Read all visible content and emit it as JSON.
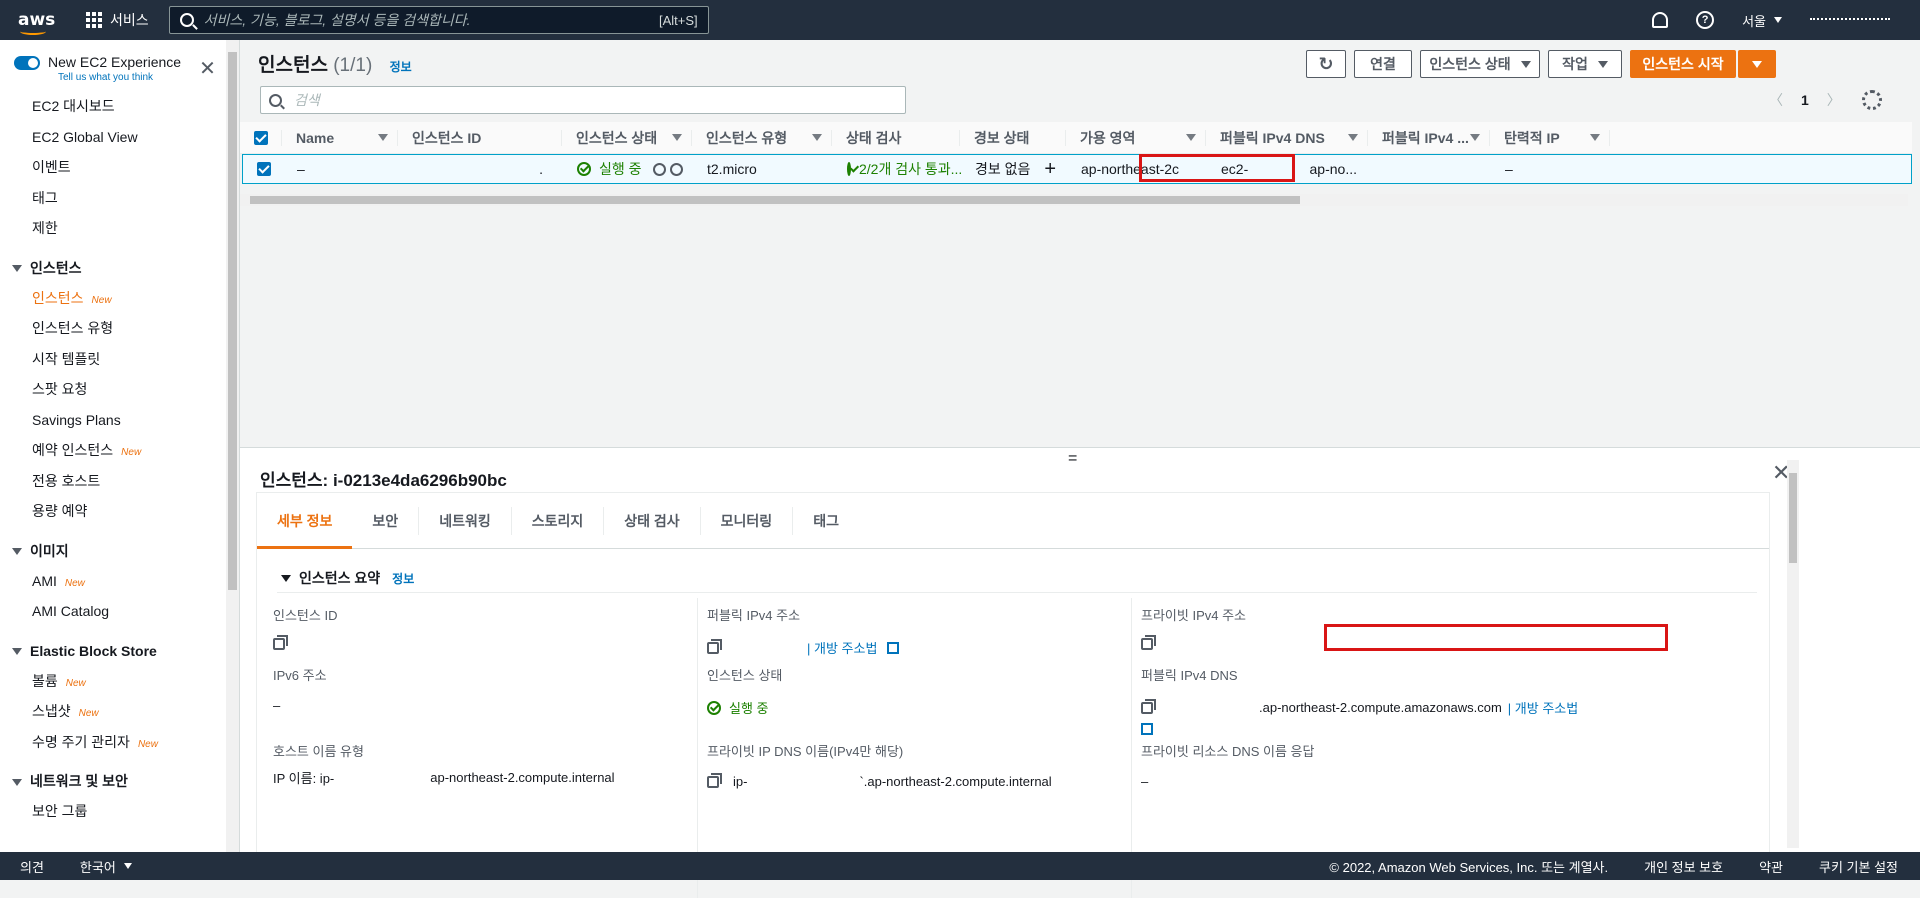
{
  "topnav": {
    "logo": "aws",
    "services_label": "서비스",
    "search_placeholder": "서비스, 기능, 블로그, 설명서 등을 검색합니다.",
    "search_shortcut": "[Alt+S]",
    "region": "서울"
  },
  "sidebar": {
    "toggle_title": "New EC2 Experience",
    "toggle_sub": "Tell us what you think",
    "top_items": [
      "EC2 대시보드",
      "EC2 Global View",
      "이벤트",
      "태그",
      "제한"
    ],
    "sections": [
      {
        "title": "인스턴스",
        "items": [
          {
            "label": "인스턴스",
            "new": "New",
            "active": true
          },
          {
            "label": "인스턴스 유형",
            "new": ""
          },
          {
            "label": "시작 템플릿",
            "new": ""
          },
          {
            "label": "스팟 요청",
            "new": ""
          },
          {
            "label": "Savings Plans",
            "new": ""
          },
          {
            "label": "예약 인스턴스",
            "new": "New"
          },
          {
            "label": "전용 호스트",
            "new": ""
          },
          {
            "label": "용량 예약",
            "new": ""
          }
        ]
      },
      {
        "title": "이미지",
        "items": [
          {
            "label": "AMI",
            "new": "New"
          },
          {
            "label": "AMI Catalog",
            "new": ""
          }
        ]
      },
      {
        "title": "Elastic Block Store",
        "items": [
          {
            "label": "볼륨",
            "new": "New"
          },
          {
            "label": "스냅샷",
            "new": "New"
          },
          {
            "label": "수명 주기 관리자",
            "new": "New"
          }
        ]
      },
      {
        "title": "네트워크 및 보안",
        "items": [
          {
            "label": "보안 그룹",
            "new": ""
          }
        ]
      }
    ]
  },
  "header": {
    "title": "인스턴스",
    "count": "(1/1)",
    "info": "정보",
    "btn_refresh": "↻",
    "btn_connect": "연결",
    "btn_state": "인스턴스 상태",
    "btn_actions": "작업",
    "btn_launch": "인스턴스 시작",
    "filter_placeholder": "검색",
    "page": "1"
  },
  "table": {
    "columns": [
      "Name",
      "인스턴스 ID",
      "인스턴스 상태",
      "인스턴스 유형",
      "상태 검사",
      "경보 상태",
      "가용 영역",
      "퍼블릭 IPv4 DNS",
      "퍼블릭 IPv4 ...",
      "탄력적 IP"
    ],
    "row": {
      "name": "–",
      "id": ".",
      "state": "실행 중",
      "type": "t2.micro",
      "check": "2/2개 검사 통과...",
      "alarm": "경보 없음",
      "alarm_add": "+",
      "az": "ap-northeast-2c",
      "dns_prefix": "ec2-",
      "dns_suffix": "ap-no...",
      "ipv4": "",
      "eip": "–"
    }
  },
  "details": {
    "handle": "=",
    "title": "인스턴스: i-0213e4da6296b90bc",
    "tabs": [
      "세부 정보",
      "보안",
      "네트워킹",
      "스토리지",
      "상태 검사",
      "모니터링",
      "태그"
    ],
    "summary": "인스턴스 요약",
    "info": "정보",
    "fields": {
      "instance_id_label": "인스턴스 ID",
      "public_ipv4_label": "퍼블릭 IPv4 주소",
      "public_ipv4_link": "| 개방 주소법",
      "private_ipv4_label": "프라이빗 IPv4 주소",
      "ipv6_label": "IPv6 주소",
      "ipv6_value": "–",
      "state_label": "인스턴스 상태",
      "state_value": "실행 중",
      "public_dns_label": "퍼블릭 IPv4 DNS",
      "public_dns_value": ".ap-northeast-2.compute.amazonaws.com",
      "public_dns_link": "| 개방 주소법",
      "hostname_type_label": "호스트 이름 유형",
      "hostname_type_value_prefix": "IP 이름: ip-",
      "hostname_type_value_suffix": "ap-northeast-2.compute.internal",
      "private_dns_label": "프라이빗 IP DNS 이름(IPv4만 해당)",
      "private_dns_prefix": "ip-",
      "private_dns_suffix": "`.ap-northeast-2.compute.internal",
      "private_resource_dns_label": "프라이빗 리소스 DNS 이름 응답",
      "private_resource_dns_value": "–"
    }
  },
  "footer": {
    "feedback": "의견",
    "language": "한국어",
    "copyright": "© 2022, Amazon Web Services, Inc. 또는 계열사.",
    "privacy": "개인 정보 보호",
    "terms": "약관",
    "cookies": "쿠키 기본 설정"
  },
  "colors": {
    "nav": "#232f3e",
    "accent": "#ec7211",
    "link": "#0073bb",
    "success": "#1d8102",
    "highlight": "#d91515"
  }
}
